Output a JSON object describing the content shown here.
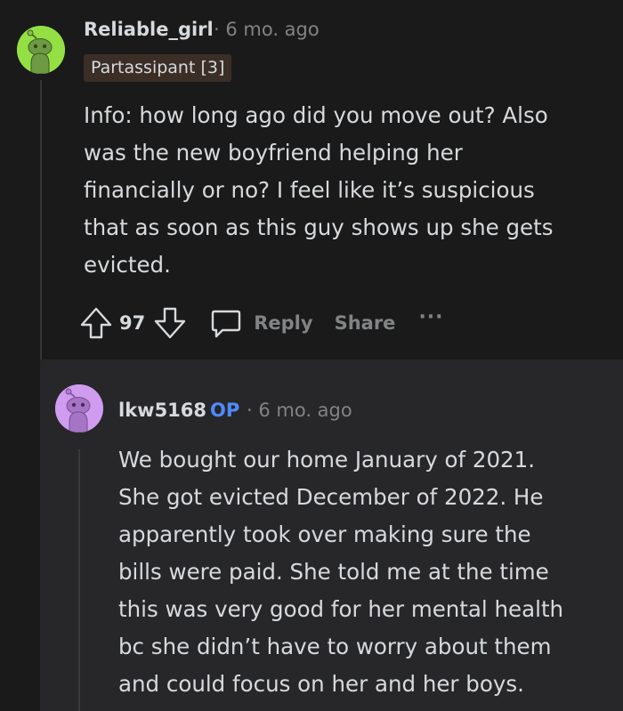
{
  "parent_comment": {
    "username": "Reliable_girl",
    "meta": "· 6 mo. ago",
    "flair": "Partassipant [3]",
    "body": "Info: how long ago did you move out? Also\nwas the new boyfriend helping her\nfinancially or no? I feel like it’s suspicious\nthat as soon as this guy shows up she gets\nevicted.",
    "vote_count": "97",
    "reply_label": "Reply",
    "share_label": "Share",
    "more_label": "···",
    "avatar_color": "#94e044"
  },
  "reply_comment": {
    "username": "lkw5168",
    "op_badge": "OP",
    "meta": "· 6 mo. ago",
    "body": "We bought our home January of 2021.\nShe got evicted December of 2022. He\napparently took over making sure the\nbills were paid. She told me at the time\nthis was very good for her mental health\nbc she didn’t have to worry about them\nand could focus on her and her boys.",
    "avatar_color": "#cf9cf0"
  },
  "colors": {
    "background": "#1a1a1b",
    "reply_background": "#272729",
    "text_primary": "#d7dadc",
    "text_muted": "#818384",
    "op_blue": "#4f8bff",
    "flair_bg": "#3b2e27"
  },
  "icons": {
    "upvote": "upvote-arrow-icon",
    "downvote": "downvote-arrow-icon",
    "reply": "speech-bubble-icon",
    "avatar": "snoo-avatar-icon"
  }
}
